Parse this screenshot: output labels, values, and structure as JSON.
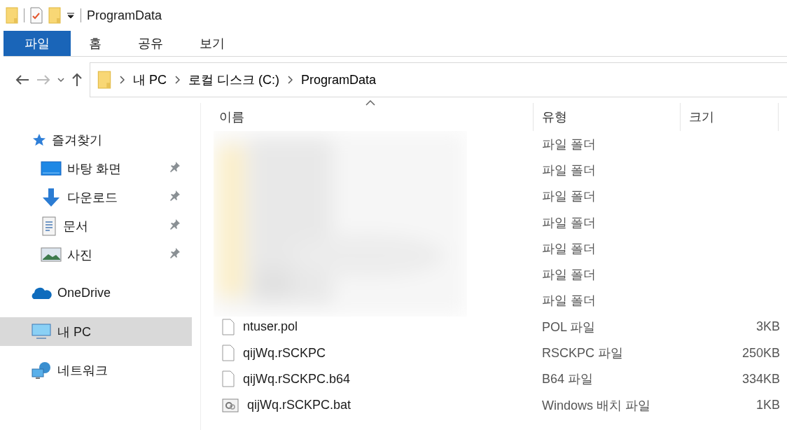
{
  "window": {
    "title": "ProgramData"
  },
  "ribbon": {
    "tabs": [
      {
        "label": "파일",
        "selected": true
      },
      {
        "label": "홈",
        "selected": false
      },
      {
        "label": "공유",
        "selected": false
      },
      {
        "label": "보기",
        "selected": false
      }
    ]
  },
  "address_bar": {
    "segments": [
      "내 PC",
      "로컬 디스크 (C:)",
      "ProgramData"
    ]
  },
  "sidebar": {
    "items": [
      {
        "kind": "star",
        "label": "즐겨찾기",
        "selected": false,
        "children": [
          {
            "kind": "desktop",
            "label": "바탕 화면",
            "pinned": true,
            "selected": false
          },
          {
            "kind": "download",
            "label": "다운로드",
            "pinned": true,
            "selected": false
          },
          {
            "kind": "document",
            "label": "문서",
            "pinned": true,
            "selected": false
          },
          {
            "kind": "photo",
            "label": "사진",
            "pinned": true,
            "selected": false
          }
        ]
      },
      {
        "kind": "cloud",
        "label": "OneDrive",
        "selected": false
      },
      {
        "kind": "pc",
        "label": "내 PC",
        "selected": true
      },
      {
        "kind": "network",
        "label": "네트워크",
        "selected": false
      }
    ]
  },
  "table": {
    "columns": [
      {
        "label": "이름",
        "sorted": true
      },
      {
        "label": "유형",
        "sorted": false
      },
      {
        "label": "크기",
        "sorted": false
      }
    ],
    "rows": [
      {
        "kind": "folder",
        "type": "파일 폴더"
      },
      {
        "kind": "folder",
        "type": "파일 폴더"
      },
      {
        "kind": "folder",
        "type": "파일 폴더"
      },
      {
        "kind": "folder",
        "type": "파일 폴더"
      },
      {
        "kind": "folder",
        "type": "파일 폴더"
      },
      {
        "kind": "folder",
        "type": "파일 폴더"
      },
      {
        "kind": "folder",
        "type": "파일 폴더"
      },
      {
        "kind": "file",
        "name": "ntuser.pol",
        "type": "POL 파일",
        "size": "3KB"
      },
      {
        "kind": "file",
        "name": "qijWq.rSCKPC",
        "type": "RSCKPC 파일",
        "size": "250KB"
      },
      {
        "kind": "file",
        "name": "qijWq.rSCKPC.b64",
        "type": "B64 파일",
        "size": "334KB"
      },
      {
        "kind": "batch",
        "name": "qijWq.rSCKPC.bat",
        "type": "Windows 배치 파일",
        "size": "1KB"
      }
    ]
  }
}
